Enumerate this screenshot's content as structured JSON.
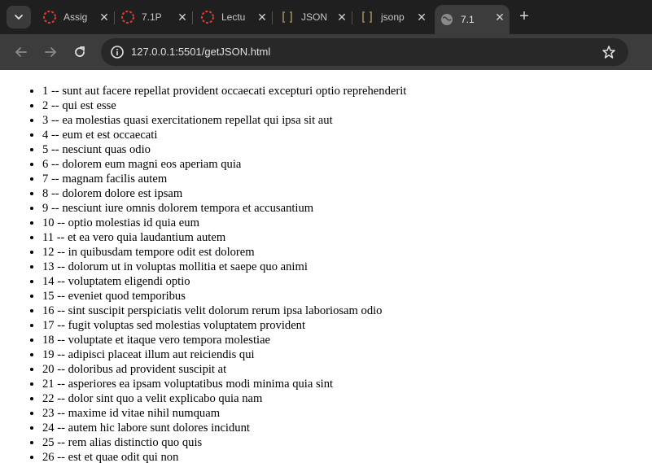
{
  "browser": {
    "tabs": [
      {
        "title": "Assig",
        "icon": "red-loading-icon",
        "active": false
      },
      {
        "title": "7.1P",
        "icon": "red-loading-icon",
        "active": false
      },
      {
        "title": "Lectu",
        "icon": "red-loading-icon",
        "active": false
      },
      {
        "title": "JSON",
        "icon": "brackets-icon",
        "active": false
      },
      {
        "title": "jsonp",
        "icon": "brackets-icon",
        "active": false
      },
      {
        "title": "7.1",
        "icon": "globe-icon",
        "active": true
      }
    ],
    "new_tab_label": "+",
    "close_label": "✕",
    "address": "127.0.0.1:5501/getJSON.html"
  },
  "todos": [
    "1 -- sunt aut facere repellat provident occaecati excepturi optio reprehenderit",
    "2 -- qui est esse",
    "3 -- ea molestias quasi exercitationem repellat qui ipsa sit aut",
    "4 -- eum et est occaecati",
    "5 -- nesciunt quas odio",
    "6 -- dolorem eum magni eos aperiam quia",
    "7 -- magnam facilis autem",
    "8 -- dolorem dolore est ipsam",
    "9 -- nesciunt iure omnis dolorem tempora et accusantium",
    "10 -- optio molestias id quia eum",
    "11 -- et ea vero quia laudantium autem",
    "12 -- in quibusdam tempore odit est dolorem",
    "13 -- dolorum ut in voluptas mollitia et saepe quo animi",
    "14 -- voluptatem eligendi optio",
    "15 -- eveniet quod temporibus",
    "16 -- sint suscipit perspiciatis velit dolorum rerum ipsa laboriosam odio",
    "17 -- fugit voluptas sed molestias voluptatem provident",
    "18 -- voluptate et itaque vero tempora molestiae",
    "19 -- adipisci placeat illum aut reiciendis qui",
    "20 -- doloribus ad provident suscipit at",
    "21 -- asperiores ea ipsam voluptatibus modi minima quia sint",
    "22 -- dolor sint quo a velit explicabo quia nam",
    "23 -- maxime id vitae nihil numquam",
    "24 -- autem hic labore sunt dolores incidunt",
    "25 -- rem alias distinctio quo quis",
    "26 -- est et quae odit qui non"
  ]
}
